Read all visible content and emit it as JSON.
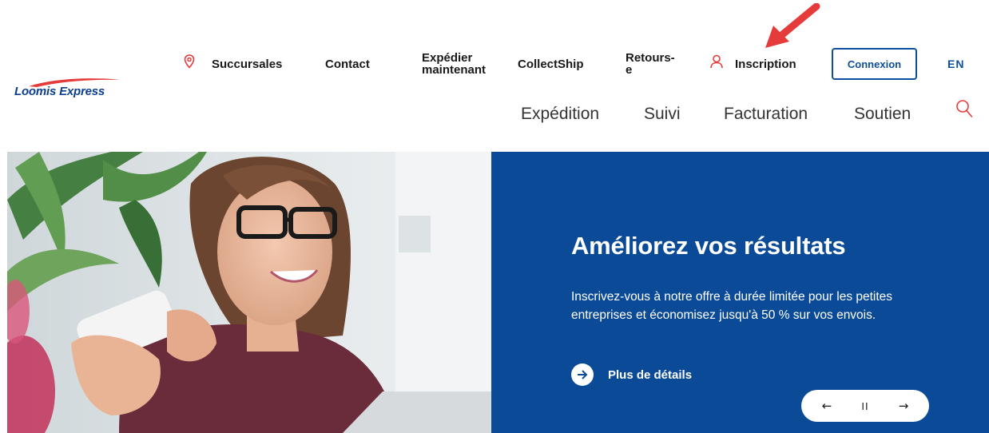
{
  "brand": {
    "logo_text": "Loomis Express",
    "primary_color": "#0b4a97",
    "accent_color": "#e63b3b"
  },
  "utility_nav": {
    "succursales": "Succursales",
    "contact": "Contact",
    "expedier_line1": "Expédier",
    "expedier_line2": "maintenant",
    "collectship": "CollectShip",
    "retours_line1": "Retours-",
    "retours_line2": "e",
    "inscription": "Inscription",
    "connexion": "Connexion",
    "language": "EN"
  },
  "main_nav": {
    "expedition": "Expédition",
    "suivi": "Suivi",
    "facturation": "Facturation",
    "soutien": "Soutien"
  },
  "icons": {
    "location": "location-pin-icon",
    "user": "user-icon",
    "search": "search-icon",
    "arrow_right": "arrow-right-icon",
    "arrow_left": "arrow-left-icon",
    "pause": "pause-icon"
  },
  "hero": {
    "title": "Améliorez vos résultats",
    "body": "Inscrivez-vous à notre offre à durée limitée pour les petites entreprises et économisez jusqu'à 50 % sur vos envois.",
    "cta_label": "Plus de détails"
  },
  "carousel": {
    "prev_glyph": "←",
    "pause_glyph": "II",
    "next_glyph": "→"
  }
}
